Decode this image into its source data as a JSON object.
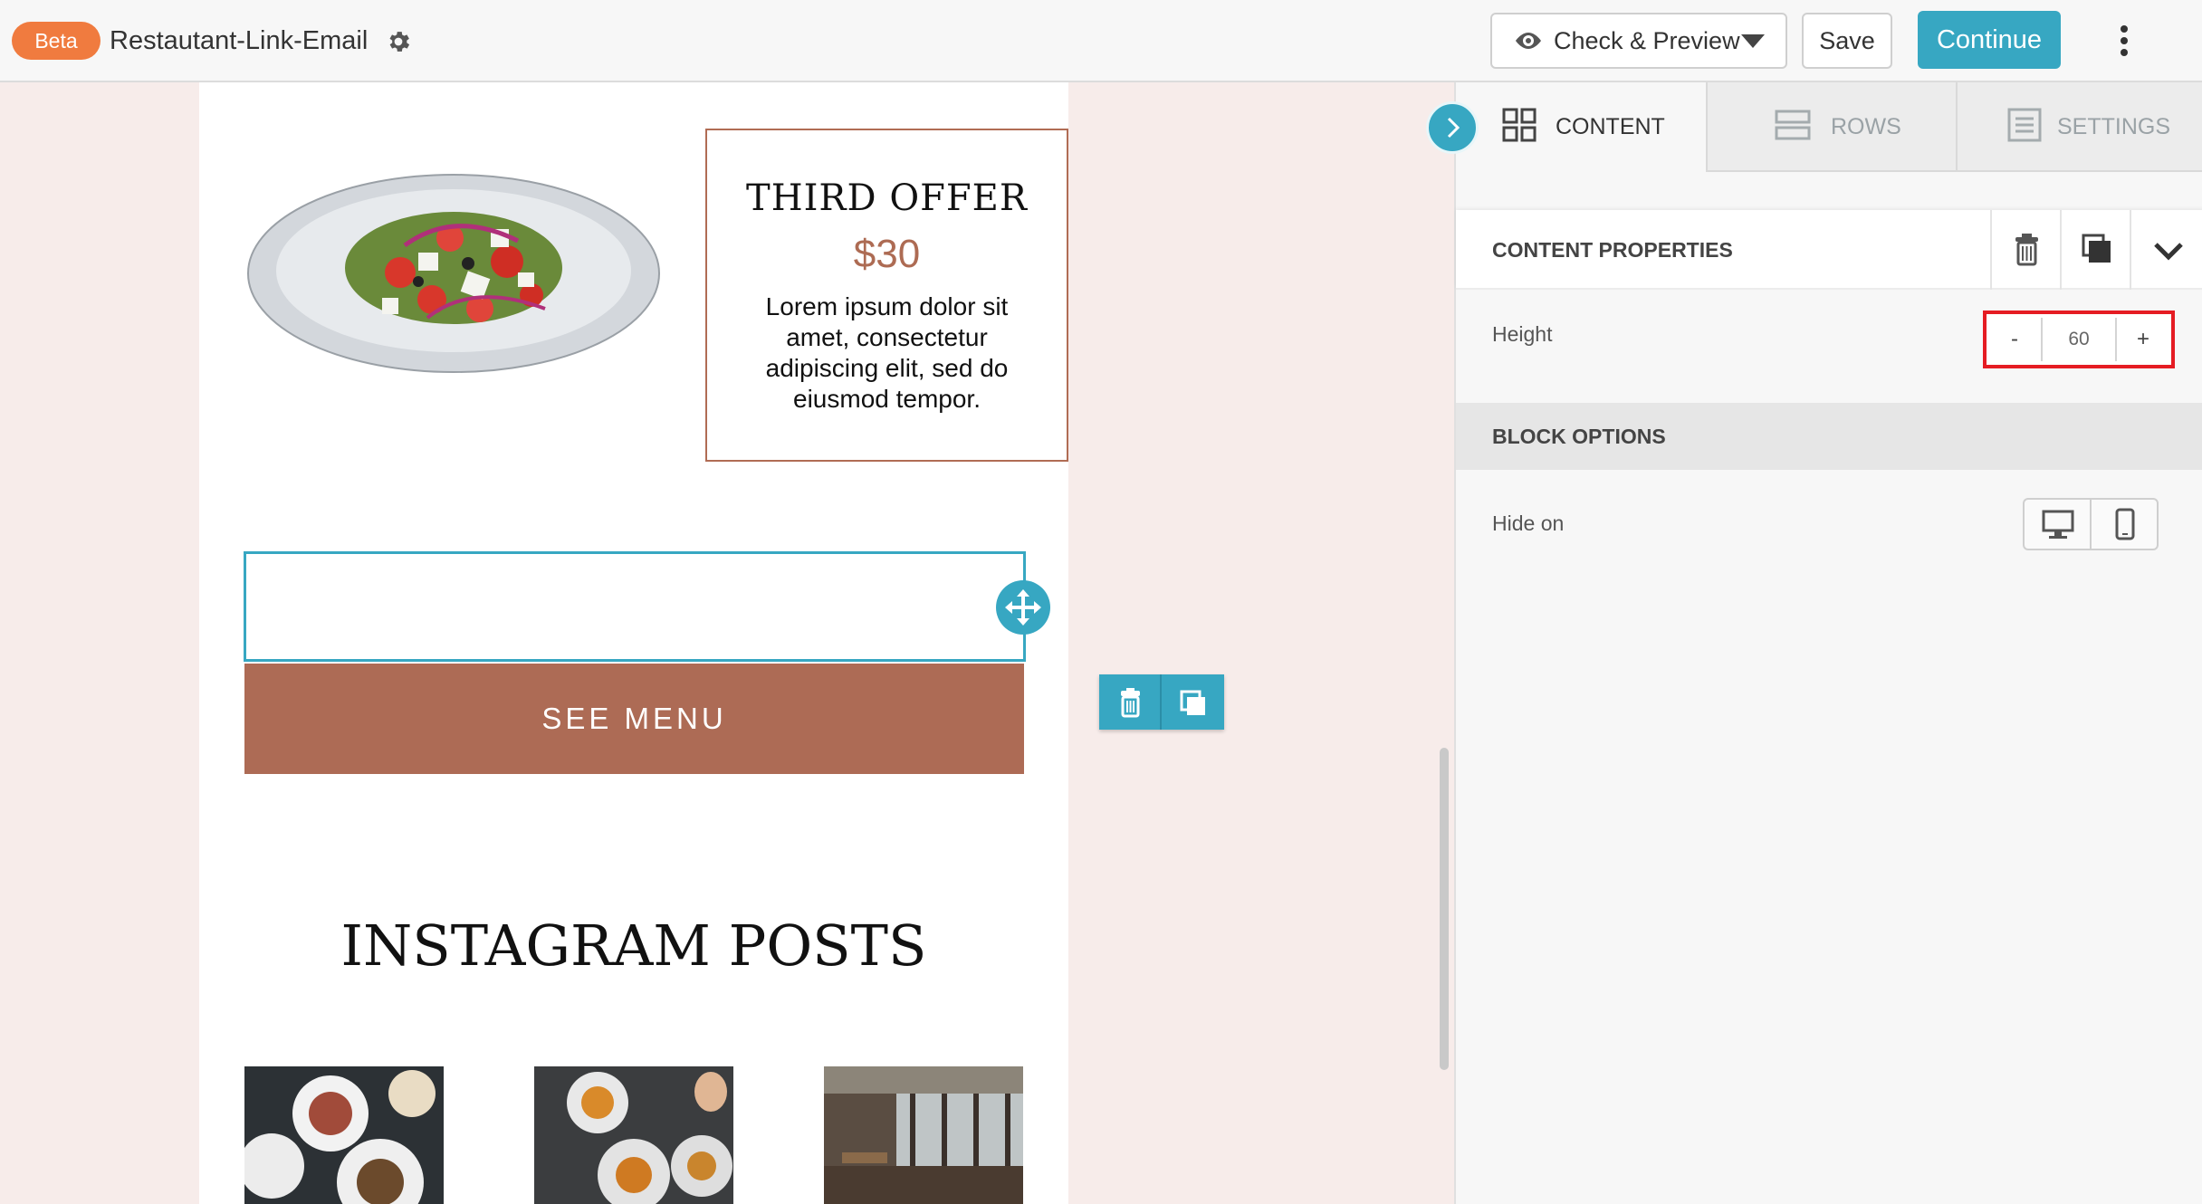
{
  "topbar": {
    "badge": "Beta",
    "project_name": "Restautant-Link-Email",
    "preview_label": "Check & Preview",
    "save_label": "Save",
    "continue_label": "Continue"
  },
  "email": {
    "offer": {
      "title": "THIRD OFFER",
      "price": "$30",
      "description": "Lorem ipsum dolor sit amet, consectetur adipiscing elit, sed do eiusmod tempor."
    },
    "menu_button": "SEE MENU",
    "instagram_title": "INSTAGRAM POSTS"
  },
  "panel": {
    "tabs": [
      {
        "label": "CONTENT",
        "icon": "grid-icon",
        "active": true
      },
      {
        "label": "ROWS",
        "icon": "rows-icon",
        "active": false
      },
      {
        "label": "SETTINGS",
        "icon": "settings-list-icon",
        "active": false
      }
    ],
    "content_properties_title": "CONTENT PROPERTIES",
    "height": {
      "label": "Height",
      "minus": "-",
      "value": "60",
      "plus": "+"
    },
    "block_options_title": "BLOCK OPTIONS",
    "hide_on_label": "Hide on"
  },
  "colors": {
    "accent": "#37a7c2",
    "beta": "#f07b3f",
    "brand_brown": "#ad6b55",
    "canvas_bg": "#f7ecea",
    "highlight": "#e51c23"
  }
}
